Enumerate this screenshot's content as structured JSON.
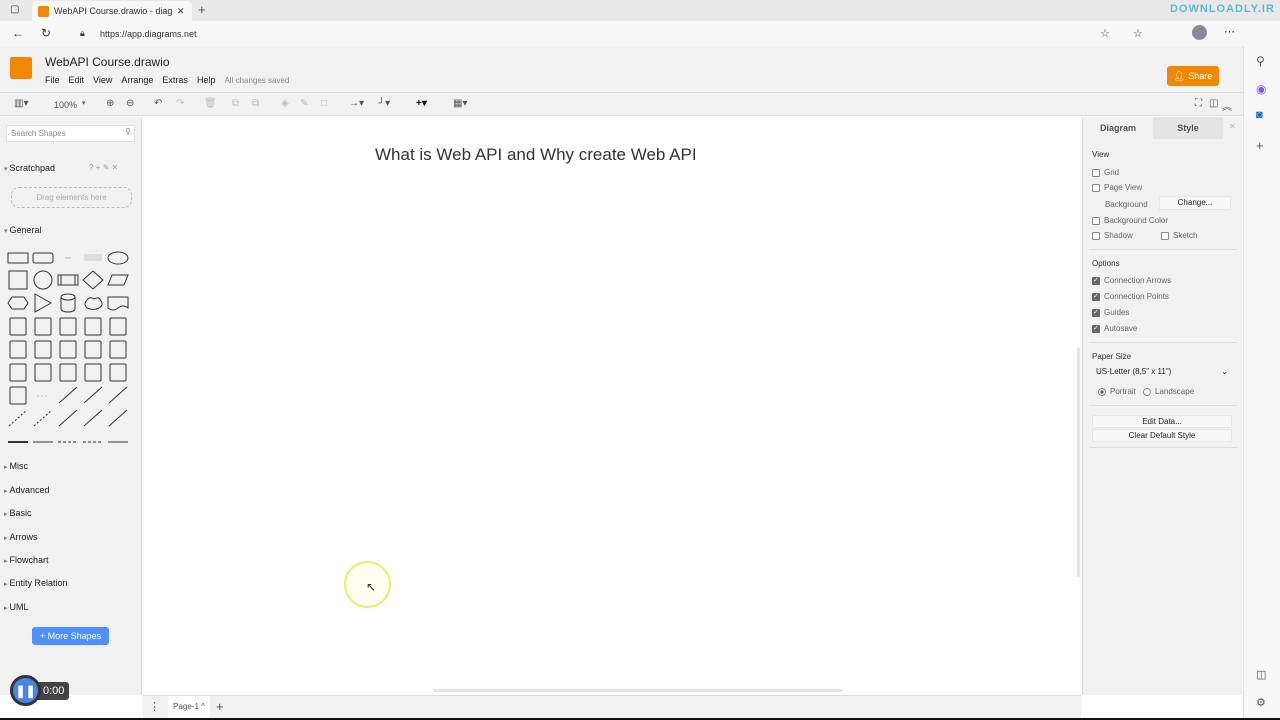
{
  "browser": {
    "tab_title": "WebAPI Course.drawio - diagram",
    "url": "https://app.diagrams.net",
    "watermark": "DOWNLOADLY.IR"
  },
  "app": {
    "title": "WebAPI Course.drawio",
    "menu": [
      "File",
      "Edit",
      "View",
      "Arrange",
      "Extras",
      "Help"
    ],
    "status": "All changes saved",
    "share": "Share",
    "accent": "#f08705"
  },
  "toolbar": {
    "zoom": "100%"
  },
  "sidebar": {
    "search_placeholder": "Search Shapes",
    "scratchpad": "Scratchpad",
    "scratch_actions": "? + ✎ ✕",
    "drag_hint": "Drag elements here",
    "general": "General",
    "shapes": [
      "rect",
      "rounded",
      "text",
      "textbox",
      "ellipse",
      "square",
      "circle",
      "process",
      "diamond",
      "parallelogram",
      "hexagon",
      "triangle",
      "cylinder",
      "cloud",
      "document",
      "internal-storage",
      "cube",
      "step",
      "trapezoid",
      "tape",
      "note",
      "card",
      "callout",
      "actor",
      "or",
      "and",
      "data-storage",
      "square2",
      "container",
      "container2",
      "list",
      "dashes",
      "curve",
      "bi-arrow",
      "arrow",
      "line-dashed",
      "line-dotted",
      "line",
      "bi-line",
      "dir-line",
      "link-thick",
      "link-arrow",
      "link-dashed",
      "link-dotted",
      "link-bar"
    ],
    "sections": [
      "Misc",
      "Advanced",
      "Basic",
      "Arrows",
      "Flowchart",
      "Entity Relation",
      "UML"
    ],
    "more_shapes": "+ More Shapes"
  },
  "canvas": {
    "heading": "What is Web API and Why create Web API"
  },
  "format_panel": {
    "tabs": [
      "Diagram",
      "Style"
    ],
    "view_label": "View",
    "grid": "Grid",
    "page_view": "Page View",
    "background": "Background",
    "change": "Change...",
    "background_color": "Background Color",
    "shadow": "Shadow",
    "sketch": "Sketch",
    "options_label": "Options",
    "connection_arrows": "Connection Arrows",
    "connection_points": "Connection Points",
    "guides": "Guides",
    "autosave": "Autosave",
    "paper_size_label": "Paper Size",
    "paper_size": "US-Letter (8,5\" x 11\")",
    "portrait": "Portrait",
    "landscape": "Landscape",
    "edit_data": "Edit Data...",
    "clear_style": "Clear Default Style"
  },
  "pages": {
    "current": "Page-1 ^"
  },
  "player": {
    "time": "0:00"
  }
}
